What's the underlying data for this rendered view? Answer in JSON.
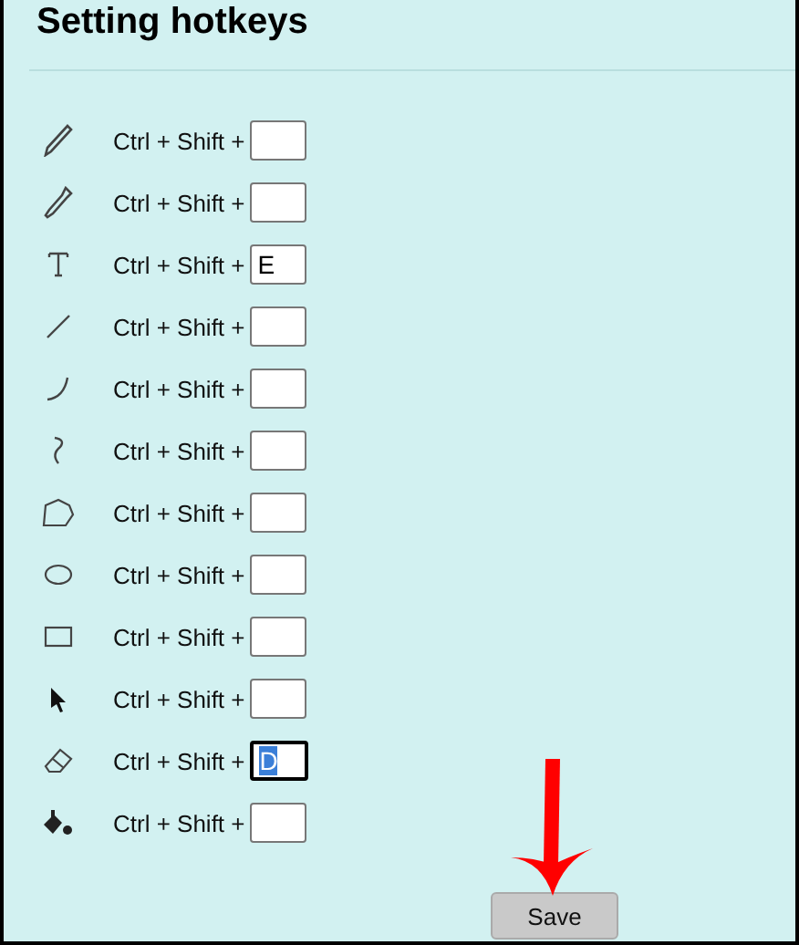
{
  "title": "Setting hotkeys",
  "rows": [
    {
      "kind": "pencil",
      "label": "Ctrl + Shift +",
      "value": "",
      "focused": false
    },
    {
      "kind": "dropper",
      "label": "Ctrl + Shift +",
      "value": "",
      "focused": false
    },
    {
      "kind": "text",
      "label": "Ctrl + Shift +",
      "value": "E",
      "focused": false
    },
    {
      "kind": "line",
      "label": "Ctrl + Shift +",
      "value": "",
      "focused": false
    },
    {
      "kind": "curve",
      "label": "Ctrl + Shift +",
      "value": "",
      "focused": false
    },
    {
      "kind": "freehand",
      "label": "Ctrl + Shift +",
      "value": "",
      "focused": false
    },
    {
      "kind": "polygon",
      "label": "Ctrl + Shift +",
      "value": "",
      "focused": false
    },
    {
      "kind": "ellipse",
      "label": "Ctrl + Shift +",
      "value": "",
      "focused": false
    },
    {
      "kind": "rectangle",
      "label": "Ctrl + Shift +",
      "value": "",
      "focused": false
    },
    {
      "kind": "pointer",
      "label": "Ctrl + Shift +",
      "value": "",
      "focused": false
    },
    {
      "kind": "eraser",
      "label": "Ctrl + Shift +",
      "value": "D",
      "focused": true
    },
    {
      "kind": "fill",
      "label": "Ctrl + Shift +",
      "value": "",
      "focused": false
    }
  ],
  "save_button": "Save",
  "arrow_to_save": true
}
